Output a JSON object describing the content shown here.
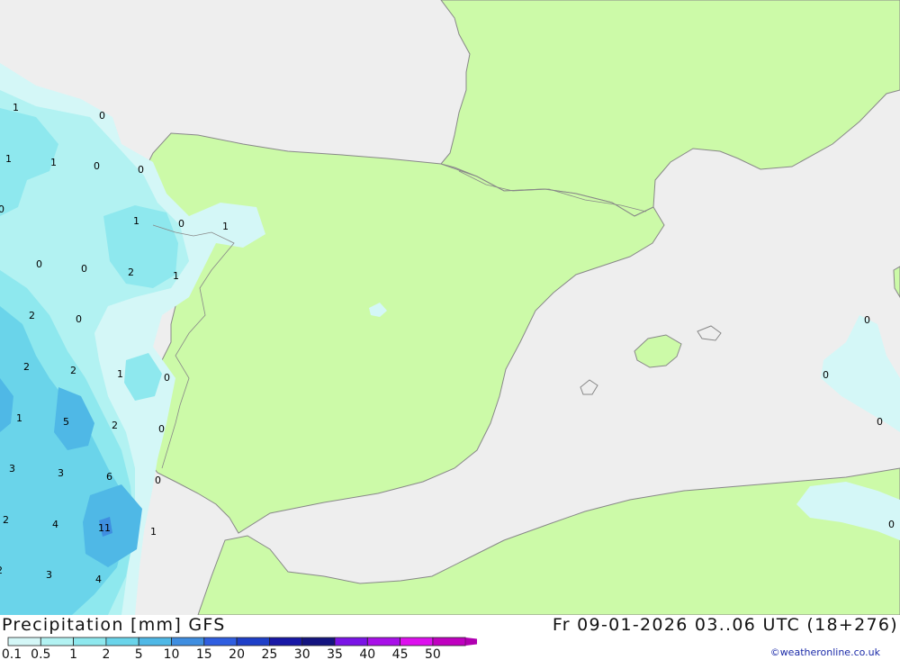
{
  "title": "Precipitation [mm] GFS",
  "valid_time": "Fr 09-01-2026 03..06 UTC (18+276)",
  "credit": "©weatheronline.co.uk",
  "colors": {
    "sea": "#eeeeee",
    "land": "#ccfaa8",
    "coast": "#888888"
  },
  "legend": {
    "labels": [
      "0.1",
      "0.5",
      "1",
      "2",
      "5",
      "10",
      "15",
      "20",
      "25",
      "30",
      "35",
      "40",
      "45",
      "50"
    ],
    "colors": [
      "#d4f7f7",
      "#b2f2f2",
      "#8ee8ee",
      "#6ad4ea",
      "#4fb8e6",
      "#3f8ee0",
      "#2f5ee0",
      "#1e3fc8",
      "#1818a6",
      "#141480",
      "#7a14e6",
      "#a810e8",
      "#dd10ee",
      "#c000c0"
    ]
  },
  "value_labels": [
    "1",
    "0",
    "1",
    "1",
    "0",
    "0",
    "0",
    "1",
    "0",
    "1",
    "0",
    "0",
    "2",
    "1",
    "2",
    "0",
    "2",
    "2",
    "1",
    "0",
    "1",
    "5",
    "2",
    "0",
    "3",
    "3",
    "6",
    "0",
    "2",
    "4",
    "11",
    "1",
    "2",
    "3",
    "4",
    "0",
    "0",
    "0",
    "0"
  ]
}
